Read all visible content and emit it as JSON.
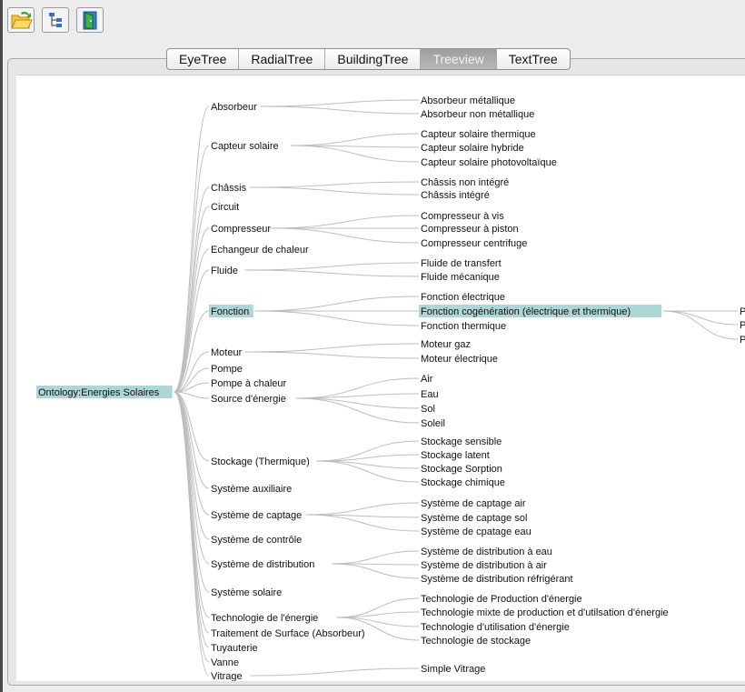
{
  "toolbar": [
    {
      "name": "open-folder-icon"
    },
    {
      "name": "tree-view-icon"
    },
    {
      "name": "exit-door-icon"
    }
  ],
  "tabs": [
    {
      "label": "EyeTree",
      "active": false
    },
    {
      "label": "RadialTree",
      "active": false
    },
    {
      "label": "BuildingTree",
      "active": false
    },
    {
      "label": "Treeview",
      "active": true
    },
    {
      "label": "TextTree",
      "active": false
    }
  ],
  "tree": {
    "root": "Ontology:Energies Solaires",
    "level1": [
      "Absorbeur",
      "Capteur solaire",
      "Châssis",
      "Circuit",
      "Compresseur",
      "Echangeur de chaleur",
      "Fluide",
      "Fonction",
      "Moteur",
      "Pompe",
      "Pompe à chaleur",
      "Source d'énergie",
      "Stockage (Thermique)",
      "Système auxiliaire",
      "Système de captage",
      "Système de contrôle",
      "Système de distribution",
      "Système solaire",
      "Technologie de l'énergie",
      "Traitement de Surface (Absorbeur)",
      "Tuyauterie",
      "Vanne",
      "Vitrage"
    ],
    "level2": [
      {
        "parent": "Absorbeur",
        "label": "Absorbeur métallique"
      },
      {
        "parent": "Absorbeur",
        "label": "Absorbeur non métallique"
      },
      {
        "parent": "Capteur solaire",
        "label": "Capteur solaire thermique"
      },
      {
        "parent": "Capteur solaire",
        "label": "Capteur solaire hybride"
      },
      {
        "parent": "Capteur solaire",
        "label": "Capteur solaire photovoltaïque"
      },
      {
        "parent": "Châssis",
        "label": "Châssis non intégré"
      },
      {
        "parent": "Châssis",
        "label": "Châssis intégré"
      },
      {
        "parent": "Compresseur",
        "label": "Compresseur à vis"
      },
      {
        "parent": "Compresseur",
        "label": "Compresseur à piston"
      },
      {
        "parent": "Compresseur",
        "label": "Compresseur centrifuge"
      },
      {
        "parent": "Fluide",
        "label": "Fluide de transfert"
      },
      {
        "parent": "Fluide",
        "label": "Fluide mécanique"
      },
      {
        "parent": "Fonction",
        "label": "Fonction électrique"
      },
      {
        "parent": "Fonction",
        "label": "Fonction cogénération (électrique et thermique)"
      },
      {
        "parent": "Fonction",
        "label": "Fonction thermique"
      },
      {
        "parent": "Moteur",
        "label": "Moteur gaz"
      },
      {
        "parent": "Moteur",
        "label": "Moteur électrique"
      },
      {
        "parent": "Source d'énergie",
        "label": "Air"
      },
      {
        "parent": "Source d'énergie",
        "label": "Eau"
      },
      {
        "parent": "Source d'énergie",
        "label": "Sol"
      },
      {
        "parent": "Source d'énergie",
        "label": "Soleil"
      },
      {
        "parent": "Stockage (Thermique)",
        "label": "Stockage sensible"
      },
      {
        "parent": "Stockage (Thermique)",
        "label": "Stockage latent"
      },
      {
        "parent": "Stockage (Thermique)",
        "label": "Stockage Sorption"
      },
      {
        "parent": "Stockage (Thermique)",
        "label": "Stockage chimique"
      },
      {
        "parent": "Système de captage",
        "label": "Système de captage air"
      },
      {
        "parent": "Système de captage",
        "label": "Système de captage sol"
      },
      {
        "parent": "Système de captage",
        "label": "Système de cpatage eau"
      },
      {
        "parent": "Système de distribution",
        "label": "Système de distribution à eau"
      },
      {
        "parent": "Système de distribution",
        "label": "Système de distribution à air"
      },
      {
        "parent": "Système de distribution",
        "label": "Système de distribution réfrigérant"
      },
      {
        "parent": "Technologie de l'énergie",
        "label": "Technologie de Production d'énergie"
      },
      {
        "parent": "Technologie de l'énergie",
        "label": "Technologie mixte de production et d'utilsation d'énergie"
      },
      {
        "parent": "Technologie de l'énergie",
        "label": "Technologie d'utilisation d'énergie"
      },
      {
        "parent": "Technologie de l'énergie",
        "label": "Technologie de stockage"
      },
      {
        "parent": "Vitrage",
        "label": "Simple Vitrage"
      }
    ],
    "level3": [
      {
        "parent": "Fonction cogénération (électrique et thermique)",
        "label": "P"
      },
      {
        "parent": "Fonction cogénération (électrique et thermique)",
        "label": "P"
      },
      {
        "parent": "Fonction cogénération (électrique et thermique)",
        "label": "P"
      }
    ],
    "highlighted": [
      "Ontology:Energies Solaires",
      "Fonction",
      "Fonction cogénération (électrique et thermique)"
    ]
  },
  "colors": {
    "highlight": "#aed6d6",
    "edge": "#bdbdbd",
    "active_tab": "#a8a8a8"
  }
}
